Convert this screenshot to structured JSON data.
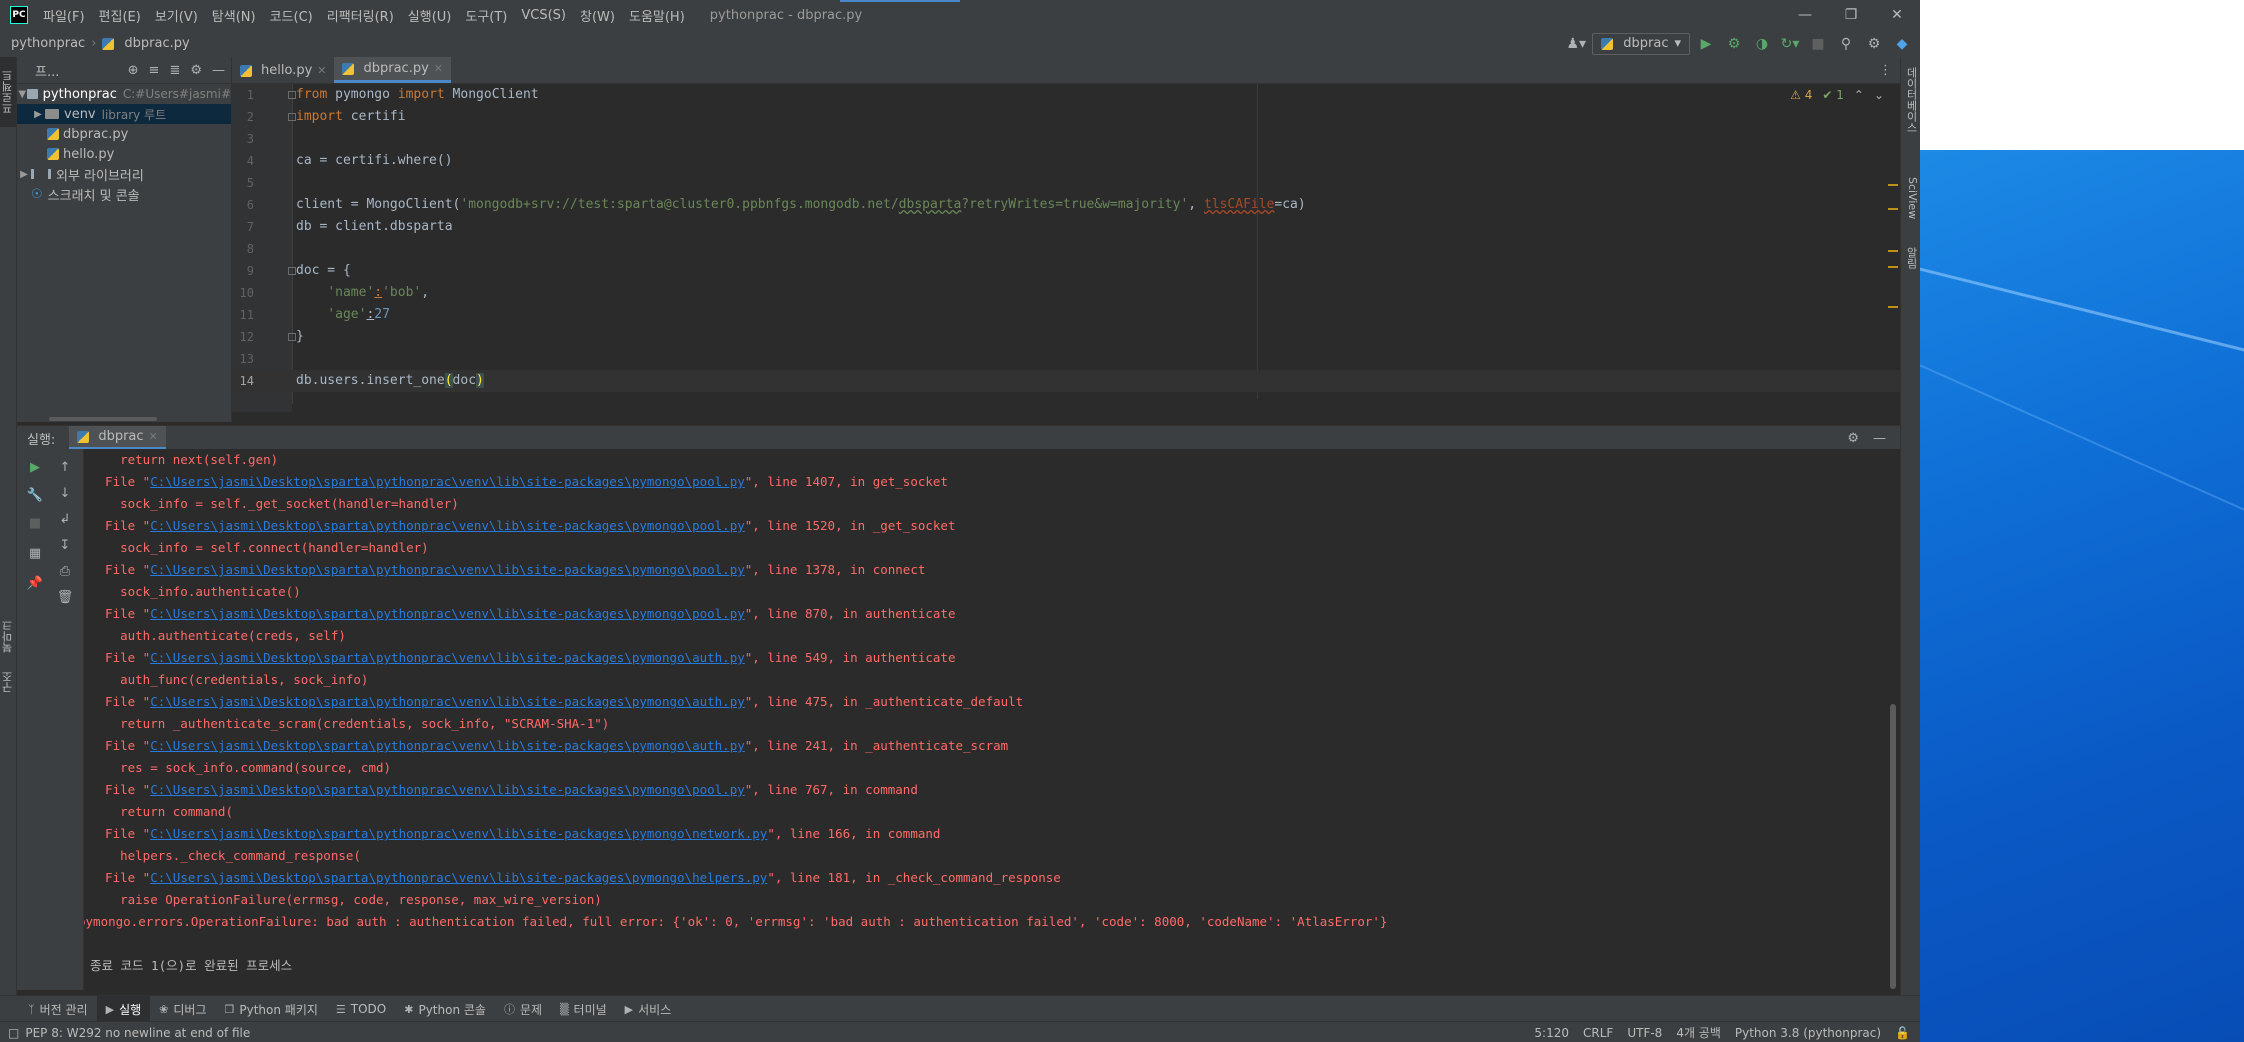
{
  "window": {
    "title": "pythonprac - dbprac.py",
    "menu": [
      "파일(F)",
      "편집(E)",
      "보기(V)",
      "탐색(N)",
      "코드(C)",
      "리팩터링(R)",
      "실행(U)",
      "도구(T)",
      "VCS(S)",
      "창(W)",
      "도움말(H)"
    ]
  },
  "navbar": {
    "project": "pythonprac",
    "file": "dbprac.py",
    "run_config": "dbprac"
  },
  "project_panel": {
    "title": "프...",
    "root": "pythonprac",
    "root_path": "C:#Users#jasmi#",
    "venv": "venv",
    "venv_hint": "library 루트",
    "files": [
      "dbprac.py",
      "hello.py"
    ],
    "external_libs": "외부 라이브러리",
    "scratches": "스크래치 및 콘솔"
  },
  "editor": {
    "tabs": [
      "hello.py",
      "dbprac.py"
    ],
    "active_tab": "dbprac.py",
    "warnings": "4",
    "weak_warnings": "1",
    "line_numbers": [
      "1",
      "2",
      "3",
      "4",
      "5",
      "6",
      "7",
      "8",
      "9",
      "10",
      "11",
      "12",
      "13",
      "14"
    ]
  },
  "left_strip": {
    "project_tab": "프로젝트",
    "bookmarks_tab": "북마크",
    "structure_tab": "구조"
  },
  "right_strip": {
    "database_tab": "데이터베이스",
    "sciview_tab": "SciView",
    "notifications_tab": "알림"
  },
  "run_panel": {
    "label": "실행:",
    "tab": "dbprac",
    "traceback": [
      {
        "type": "code",
        "text": "    return next(self.gen)"
      },
      {
        "type": "file",
        "path": "C:\\Users\\jasmi\\Desktop\\sparta\\pythonprac\\venv\\lib\\site-packages\\pymongo\\pool.py",
        "rest": ", line 1407, in get_socket"
      },
      {
        "type": "code",
        "text": "    sock_info = self._get_socket(handler=handler)"
      },
      {
        "type": "file",
        "path": "C:\\Users\\jasmi\\Desktop\\sparta\\pythonprac\\venv\\lib\\site-packages\\pymongo\\pool.py",
        "rest": ", line 1520, in _get_socket"
      },
      {
        "type": "code",
        "text": "    sock_info = self.connect(handler=handler)"
      },
      {
        "type": "file",
        "path": "C:\\Users\\jasmi\\Desktop\\sparta\\pythonprac\\venv\\lib\\site-packages\\pymongo\\pool.py",
        "rest": ", line 1378, in connect"
      },
      {
        "type": "code",
        "text": "    sock_info.authenticate()"
      },
      {
        "type": "file",
        "path": "C:\\Users\\jasmi\\Desktop\\sparta\\pythonprac\\venv\\lib\\site-packages\\pymongo\\pool.py",
        "rest": ", line 870, in authenticate"
      },
      {
        "type": "code",
        "text": "    auth.authenticate(creds, self)"
      },
      {
        "type": "file",
        "path": "C:\\Users\\jasmi\\Desktop\\sparta\\pythonprac\\venv\\lib\\site-packages\\pymongo\\auth.py",
        "rest": ", line 549, in authenticate"
      },
      {
        "type": "code",
        "text": "    auth_func(credentials, sock_info)"
      },
      {
        "type": "file",
        "path": "C:\\Users\\jasmi\\Desktop\\sparta\\pythonprac\\venv\\lib\\site-packages\\pymongo\\auth.py",
        "rest": ", line 475, in _authenticate_default"
      },
      {
        "type": "code",
        "text": "    return _authenticate_scram(credentials, sock_info, \"SCRAM-SHA-1\")"
      },
      {
        "type": "file",
        "path": "C:\\Users\\jasmi\\Desktop\\sparta\\pythonprac\\venv\\lib\\site-packages\\pymongo\\auth.py",
        "rest": ", line 241, in _authenticate_scram"
      },
      {
        "type": "code",
        "text": "    res = sock_info.command(source, cmd)"
      },
      {
        "type": "file",
        "path": "C:\\Users\\jasmi\\Desktop\\sparta\\pythonprac\\venv\\lib\\site-packages\\pymongo\\pool.py",
        "rest": ", line 767, in command"
      },
      {
        "type": "code",
        "text": "    return command("
      },
      {
        "type": "file",
        "path": "C:\\Users\\jasmi\\Desktop\\sparta\\pythonprac\\venv\\lib\\site-packages\\pymongo\\network.py",
        "rest": ", line 166, in command"
      },
      {
        "type": "code",
        "text": "    helpers._check_command_response("
      },
      {
        "type": "file",
        "path": "C:\\Users\\jasmi\\Desktop\\sparta\\pythonprac\\venv\\lib\\site-packages\\pymongo\\helpers.py",
        "rest": ", line 181, in _check_command_response"
      },
      {
        "type": "code",
        "text": "    raise OperationFailure(errmsg, code, response, max_wire_version)"
      },
      {
        "type": "error",
        "text": "pymongo.errors.OperationFailure: bad auth : authentication failed, full error: {'ok': 0, 'errmsg': 'bad auth : authentication failed', 'code': 8000, 'codeName': 'AtlasError'}"
      },
      {
        "type": "blank",
        "text": ""
      },
      {
        "type": "normal",
        "text": "종료 코드 1(으)로 완료된 프로세스"
      }
    ]
  },
  "bottom_tools": [
    "버전 관리",
    "실행",
    "디버그",
    "Python 패키지",
    "TODO",
    "Python 콘솔",
    "문제",
    "터미널",
    "서비스"
  ],
  "status": {
    "message": "PEP 8: W292 no newline at end of file",
    "position": "5:120",
    "line_sep": "CRLF",
    "encoding": "UTF-8",
    "indent": "4개 공백",
    "interpreter": "Python 3.8 (pythonprac)"
  },
  "colors": {
    "accent": "#4a88c7",
    "error_text": "#ff6b68",
    "link": "#287bde"
  }
}
